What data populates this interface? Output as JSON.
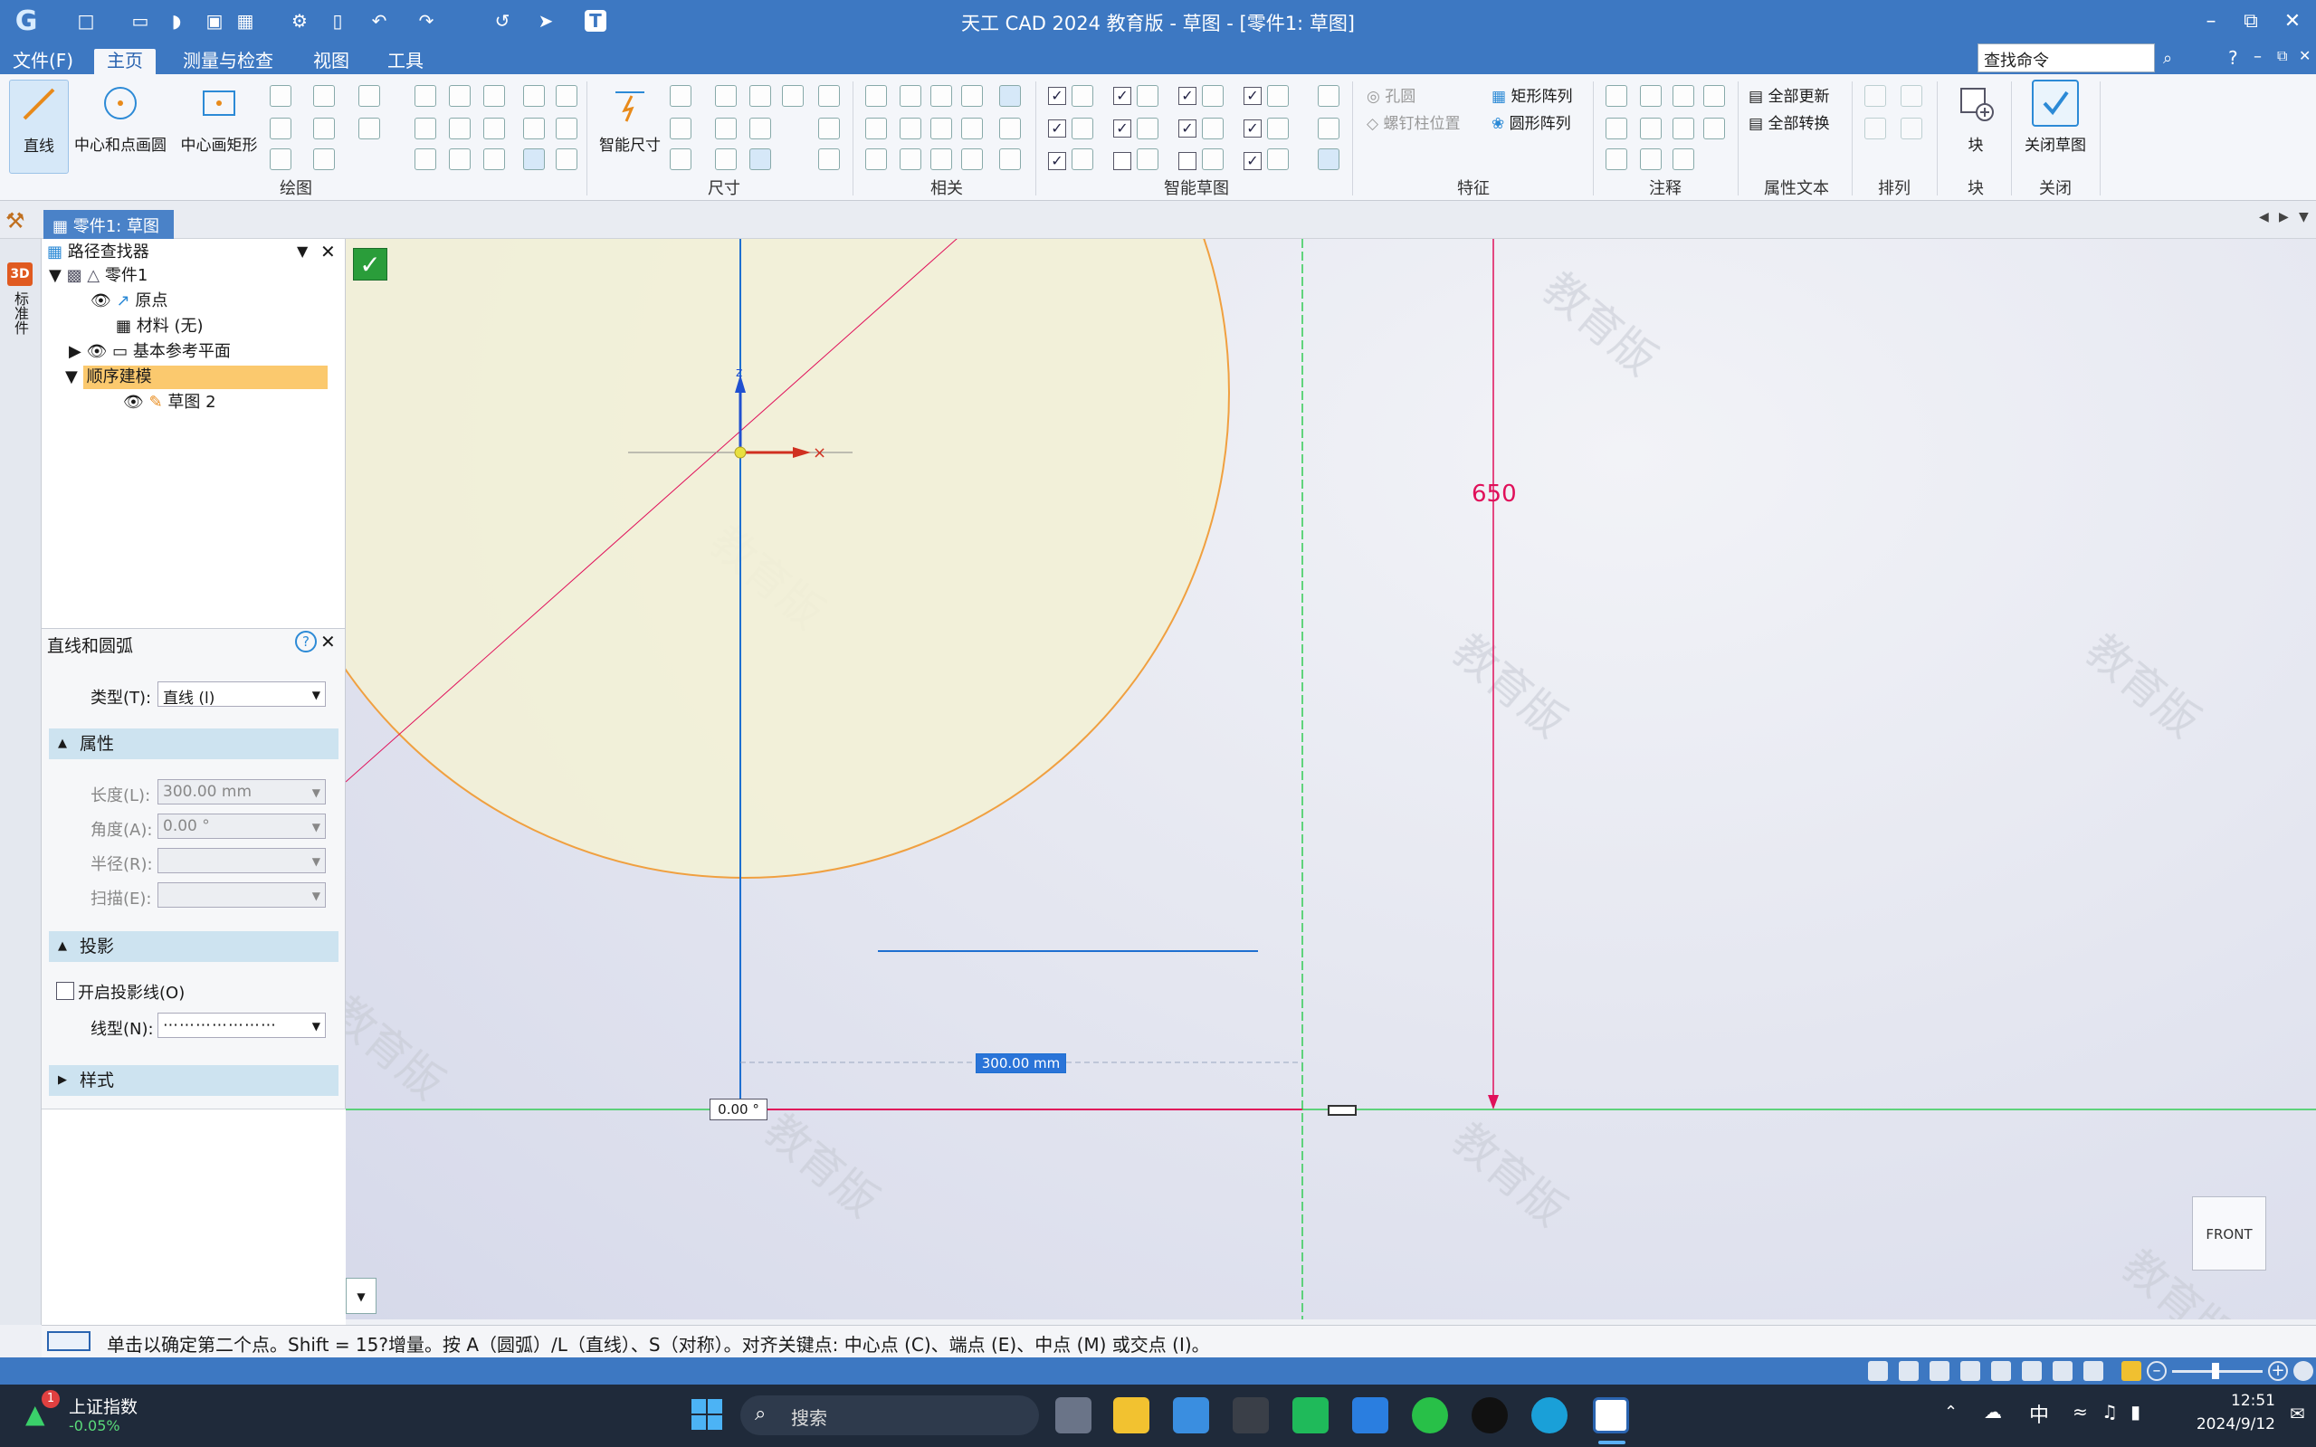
{
  "app": {
    "title": "天工 CAD 2024 教育版 - 草图 - [零件1: 草图]",
    "help": "?"
  },
  "menu": {
    "file": "文件(F)",
    "home": "主页",
    "measure": "测量与检查",
    "view": "视图",
    "tools": "工具",
    "search_value": "查找命令"
  },
  "ribbon": {
    "line": "直线",
    "circle": "中心和点画圆",
    "rect": "中心画矩形",
    "group_draw": "绘图",
    "smart_dim": "智能尺寸",
    "group_dim": "尺寸",
    "group_rel": "相关",
    "group_smart": "智能草图",
    "hole": "孔圆",
    "bolt": "螺钉柱位置",
    "rect_array": "矩形阵列",
    "circ_array": "圆形阵列",
    "group_feature": "特征",
    "group_anno": "注释",
    "update_all": "全部更新",
    "convert_all": "全部转换",
    "group_attr": "属性文本",
    "group_arrange": "排列",
    "block": "块",
    "group_block": "块",
    "close_sketch": "关闭草图",
    "group_close": "关闭"
  },
  "doc_tab": "零件1: 草图",
  "side_strip": "标准件",
  "pathfinder": {
    "title": "路径查找器",
    "items": [
      "零件1",
      "原点",
      "材料 (无)",
      "基本参考平面",
      "顺序建模",
      "草图 2"
    ]
  },
  "props": {
    "title": "直线和圆弧",
    "type_label": "类型(T):",
    "type_value": "直线 (l)",
    "sec_attr": "属性",
    "length_label": "长度(L):",
    "length_value": "300.00 mm",
    "angle_label": "角度(A):",
    "angle_value": "0.00 °",
    "radius_label": "半径(R):",
    "sweep_label": "扫描(E):",
    "sec_proj": "投影",
    "proj_check": "开启投影线(O)",
    "linetype_label": "线型(N):",
    "sec_style": "样式"
  },
  "canvas": {
    "dim_650": "650",
    "len_box": "300.00 mm",
    "angle_box": "0.00 °",
    "axis_z": "z",
    "axis_x": "×",
    "view_cube": "FRONT",
    "watermark": "教育版"
  },
  "status": {
    "text": "单击以确定第二个点。Shift = 15?增量。按 A（圆弧）/L（直线）、S（对称）。对齐关键点: 中心点 (C)、端点 (E)、中点 (M) 或交点 (I)。"
  },
  "taskbar": {
    "stock_name": "上证指数",
    "stock_change": "-0.05%",
    "badge": "1",
    "search": "搜索",
    "ime": "中",
    "time": "12:51",
    "date": "2024/9/12"
  },
  "colors": {
    "titlebar": "#3d78c2",
    "circle_fill": "#f3f1d6",
    "circle_stroke": "#f0a040",
    "magenta": "#e0105a",
    "axis_blue": "#1e6fd0",
    "green_guide": "#33cc55"
  }
}
